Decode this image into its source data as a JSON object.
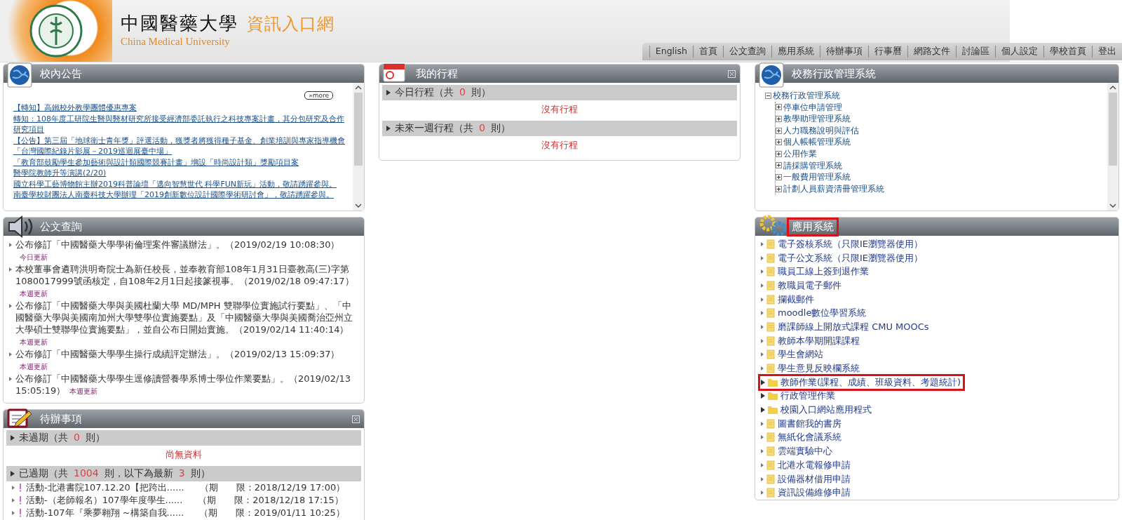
{
  "header": {
    "title": "中國醫藥大學",
    "subtitle": "資訊入口網",
    "english_name": "China Medical University"
  },
  "nav": [
    "English",
    "首頁",
    "公文查詢",
    "應用系統",
    "待辦事項",
    "行事曆",
    "網路文件",
    "討論區",
    "個人設定",
    "學校首頁",
    "登出"
  ],
  "announcements": {
    "title": "校內公告",
    "more": "»more",
    "items": [
      "【轉知】高鐵校外教學團體優惠專案",
      "轉知：108年度工研院生醫與醫材研究所接受經濟部委託執行之科技專案計畫，其分包研究及合作研究項目",
      "【公告】第三屆「地球衛士青年獎」評選活動，獲獎者將獲得種子基金、創業培訓與專家指導機會",
      "「台灣國際紀錄片影展－2019巡迴展臺中場」",
      "「教育部鼓勵學生參加藝術與設計類國際競賽計畫」增設「時尚設計類」獎勵項目案",
      "醫學院教師升等演講(2/20)",
      "國立科學工藝博物館主辦2019科普論壇「邁向智慧世代 科學FUN新玩」活動，敬請踴躍參與。",
      "南臺學校財團法人南臺科技大學辦理「2019創新數位設計國際學術研討會」，敬請踴躍參與。"
    ]
  },
  "schedule": {
    "title": "我的行程",
    "sections": [
      {
        "segments": [
          {
            "kind": "plain",
            "text": "今日行程（共"
          },
          {
            "kind": "count",
            "text": "0"
          },
          {
            "kind": "plain",
            "text": "則）"
          }
        ],
        "empty": "沒有行程"
      },
      {
        "segments": [
          {
            "kind": "plain",
            "text": "未來一週行程（共"
          },
          {
            "kind": "count",
            "text": "0"
          },
          {
            "kind": "plain",
            "text": "則）"
          }
        ],
        "empty": "沒有行程"
      }
    ]
  },
  "admin": {
    "title": "校務行政管理系統",
    "tree": [
      {
        "label": "校務行政管理系統",
        "expanded": true,
        "children": [
          {
            "label": "停車位申請管理",
            "expanded": false
          },
          {
            "label": "教學助理管理系統",
            "expanded": false
          },
          {
            "label": "人力職務說明與評估",
            "expanded": false
          },
          {
            "label": "個人帳帳管理系統",
            "expanded": false
          },
          {
            "label": "公用作業",
            "expanded": false
          },
          {
            "label": "請採購管理系統",
            "expanded": false
          },
          {
            "label": "一般費用管理系統",
            "expanded": false
          },
          {
            "label": "計劃人員薪資清冊管理系統",
            "expanded": false
          }
        ]
      }
    ]
  },
  "documents": {
    "title": "公文查詢",
    "items": [
      {
        "text": "公布修訂「中國醫藥大學學術倫理案件審議辦法」。（2019/02/19 10:08:30）",
        "badge": "今日更新"
      },
      {
        "text": "本校董事會遴聘洪明奇院士為新任校長，並奉教育部108年1月31日臺教高(三)字第1080017999號函核定，自108年2月1日起接篆視事。（2019/02/18 09:47:17）",
        "badge": "本週更新"
      },
      {
        "text": "公布修訂「中國醫藥大學與美國杜蘭大學 MD/MPH 雙聯學位實施試行要點」、「中國醫藥大學與美國南加州大學雙學位實施要點」及「中國醫藥大學與美國喬治亞州立大學碩士雙聯學位實施要點」，並自公布日開始實施。（2019/02/14 11:40:14）",
        "badge": "本週更新"
      },
      {
        "text": "公布修訂「中國醫藥大學學生操行成績評定辦法」。（2019/02/13 15:09:37）",
        "badge": "本週更新"
      },
      {
        "text": "公布修訂「中國醫藥大學學生逕修讀營養學系博士學位作業要點」。（2019/02/13 15:05:19）",
        "badge": "本週更新"
      }
    ]
  },
  "todo": {
    "title": "待辦事項",
    "sections": [
      {
        "segments": [
          {
            "kind": "plain",
            "text": "未過期（共"
          },
          {
            "kind": "count",
            "text": "0"
          },
          {
            "kind": "plain",
            "text": "則）"
          }
        ],
        "empty": "尚無資料"
      },
      {
        "segments": [
          {
            "kind": "plain",
            "text": "已過期（共"
          },
          {
            "kind": "count",
            "text": "1004"
          },
          {
            "kind": "plain",
            "text": "則，以下為最新"
          },
          {
            "kind": "count",
            "text": "3"
          },
          {
            "kind": "plain",
            "text": "則）"
          }
        ],
        "items": [
          {
            "title": "活動-北港書院107.12.20【把跨出......",
            "deadline": "（期　　限：2018/12/19 17:00）"
          },
          {
            "title": "活動-（老師報名）107學年度學生......",
            "deadline": "（期　　限：2018/12/18 17:15）"
          },
          {
            "title": "活動-107年『乘夢翱翔 ~構築自我......",
            "deadline": "（期　　限：2019/01/11 10:25）"
          }
        ]
      }
    ]
  },
  "apps": {
    "title": "應用系統",
    "highlighted": true,
    "items": [
      {
        "label": "電子簽核系統（只限IE瀏覽器使用）",
        "kind": "file",
        "highlighted": false
      },
      {
        "label": "電子公文系統（只限IE瀏覽器使用）",
        "kind": "file",
        "highlighted": false
      },
      {
        "label": "職員工線上簽到退作業",
        "kind": "file",
        "highlighted": false
      },
      {
        "label": "教職員電子郵件",
        "kind": "file",
        "highlighted": false
      },
      {
        "label": "攔截郵件",
        "kind": "file",
        "highlighted": false
      },
      {
        "label": "moodle數位學習系統",
        "kind": "file",
        "highlighted": false
      },
      {
        "label": "磨課師線上開放式課程 CMU MOOCs",
        "kind": "file",
        "highlighted": false
      },
      {
        "label": "教師本學期開課課程",
        "kind": "file",
        "highlighted": false
      },
      {
        "label": "學生會網站",
        "kind": "file",
        "highlighted": false
      },
      {
        "label": "學生意見反映欄系統",
        "kind": "file",
        "highlighted": false
      },
      {
        "label": "教師作業(課程、成績、班級資料、考題統計)",
        "kind": "folder",
        "highlighted": true
      },
      {
        "label": "行政管理作業",
        "kind": "folder",
        "highlighted": false
      },
      {
        "label": "校園入口網站應用程式",
        "kind": "folder",
        "highlighted": false
      },
      {
        "label": "圖書館我的書房",
        "kind": "file",
        "highlighted": false
      },
      {
        "label": "無紙化會議系統",
        "kind": "file",
        "highlighted": false
      },
      {
        "label": "雲端實驗中心",
        "kind": "file",
        "highlighted": false
      },
      {
        "label": "北港水電報修申請",
        "kind": "file",
        "highlighted": false
      },
      {
        "label": "設備器材借用申請",
        "kind": "file",
        "highlighted": false
      },
      {
        "label": "資訊設備維修申請",
        "kind": "file",
        "highlighted": false
      }
    ]
  }
}
